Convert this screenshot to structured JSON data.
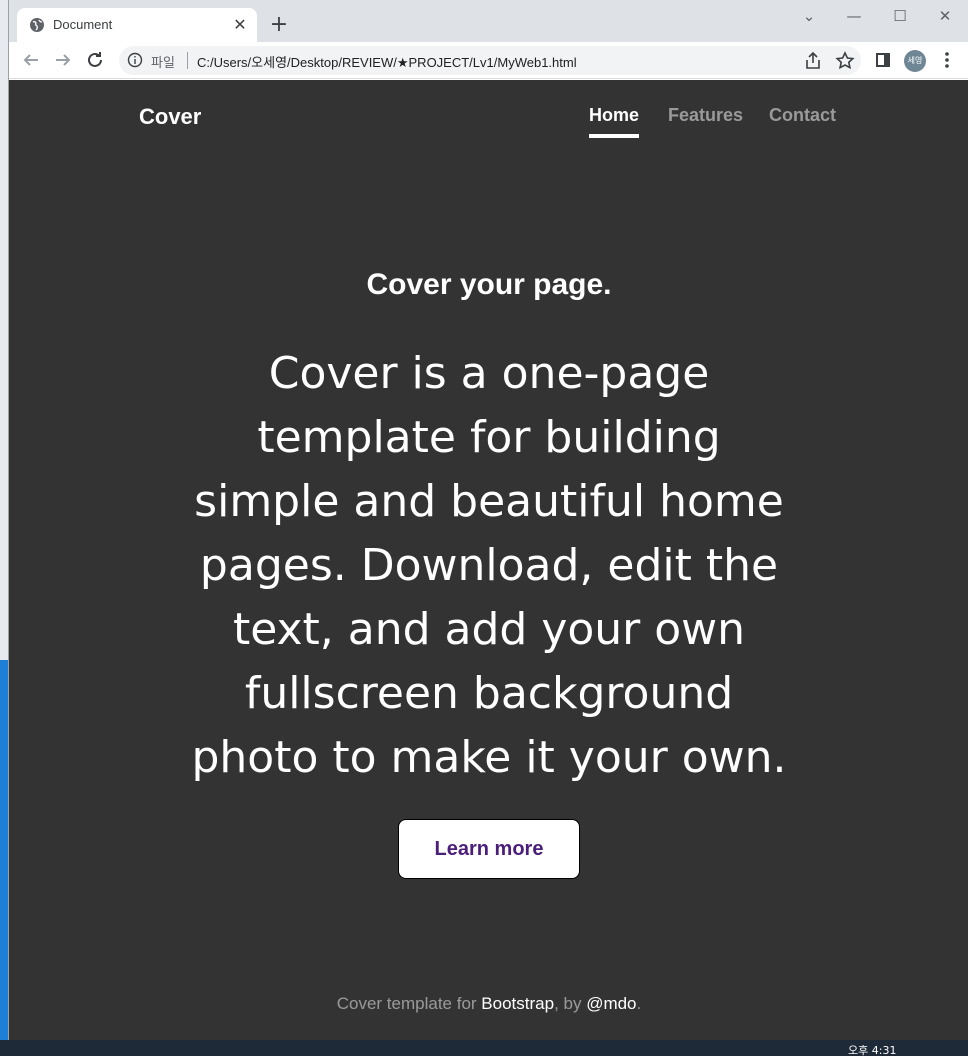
{
  "browser": {
    "tab_title": "Document",
    "scheme_label": "파일",
    "url": "C:/Users/오세영/Desktop/REVIEW/★PROJECT/Lv1/MyWeb1.html",
    "profile_initials": "세영"
  },
  "page": {
    "brand": "Cover",
    "nav": [
      "Home",
      "Features",
      "Contact"
    ],
    "heading": "Cover your page.",
    "lead": "Cover is a one-page template for building simple and beautiful home pages. Download, edit the text, and add your own fullscreen background photo to make it your own.",
    "button_label": "Learn more",
    "footer": {
      "prefix": "Cover template for ",
      "link1": "Bootstrap",
      "middle": ", by ",
      "link2": "@mdo",
      "suffix": "."
    }
  },
  "taskbar": {
    "clock": "오후 4:31"
  }
}
